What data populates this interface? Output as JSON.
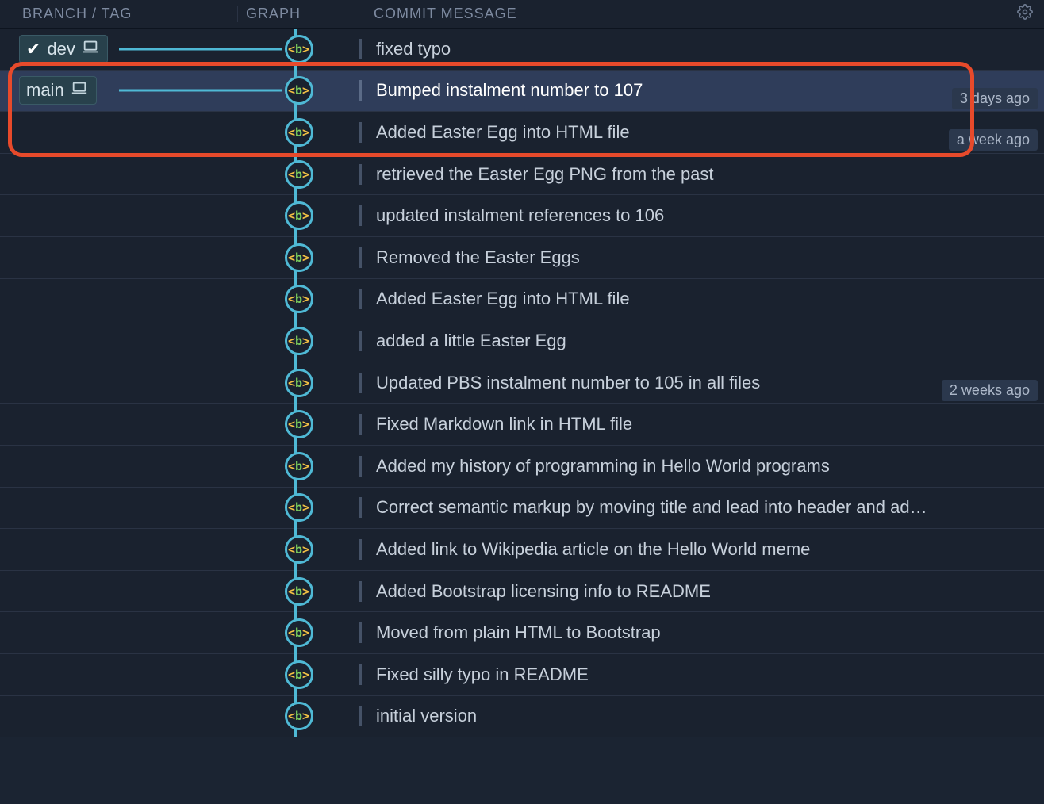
{
  "header": {
    "branch_col": "BRANCH / TAG",
    "graph_col": "GRAPH",
    "msg_col": "COMMIT MESSAGE",
    "gear_icon": "gear-icon"
  },
  "node_glyph": {
    "lt": "<",
    "b": "b",
    "gt": ">"
  },
  "branches": {
    "dev": {
      "label": "dev",
      "checked": true
    },
    "main": {
      "label": "main",
      "checked": false
    }
  },
  "commits": [
    {
      "branch": "dev",
      "message": "fixed typo",
      "selected": false,
      "time_after": "3 days ago"
    },
    {
      "branch": "main",
      "message": "Bumped instalment number to 107",
      "selected": true,
      "time_after": "a week ago"
    },
    {
      "branch": null,
      "message": "Added Easter Egg into HTML file",
      "selected": false,
      "time_after": null
    },
    {
      "branch": null,
      "message": "retrieved the Easter Egg PNG from the past",
      "selected": false,
      "time_after": null
    },
    {
      "branch": null,
      "message": "updated instalment references to 106",
      "selected": false,
      "time_after": null
    },
    {
      "branch": null,
      "message": "Removed the Easter Eggs",
      "selected": false,
      "time_after": null
    },
    {
      "branch": null,
      "message": "Added Easter Egg into HTML file",
      "selected": false,
      "time_after": null
    },
    {
      "branch": null,
      "message": "added a little Easter Egg",
      "selected": false,
      "time_after": "2 weeks ago"
    },
    {
      "branch": null,
      "message": "Updated PBS instalment number to 105 in all files",
      "selected": false,
      "time_after": null
    },
    {
      "branch": null,
      "message": "Fixed Markdown link in HTML file",
      "selected": false,
      "time_after": null
    },
    {
      "branch": null,
      "message": "Added my history of programming in Hello World programs",
      "selected": false,
      "time_after": null
    },
    {
      "branch": null,
      "message": "Correct semantic markup by moving title and lead into header and ad…",
      "selected": false,
      "time_after": null
    },
    {
      "branch": null,
      "message": "Added link to Wikipedia article on the Hello World meme",
      "selected": false,
      "time_after": null
    },
    {
      "branch": null,
      "message": "Added Bootstrap licensing info to README",
      "selected": false,
      "time_after": null
    },
    {
      "branch": null,
      "message": "Moved from plain HTML to Bootstrap",
      "selected": false,
      "time_after": null
    },
    {
      "branch": null,
      "message": "Fixed silly typo in README",
      "selected": false,
      "time_after": null
    },
    {
      "branch": null,
      "message": "initial version",
      "selected": false,
      "time_after": null
    }
  ],
  "colors": {
    "graph_line": "#4fb9d5",
    "highlight": "#e74a2b",
    "selected_bg": "#2f3d5a"
  }
}
